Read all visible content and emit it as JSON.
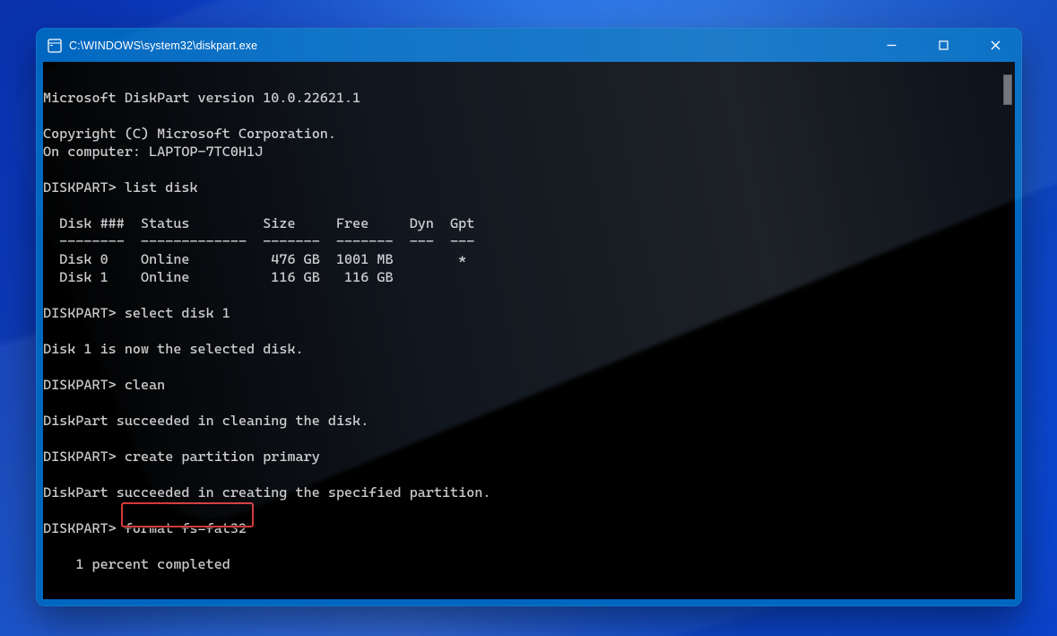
{
  "window": {
    "title": "C:\\WINDOWS\\system32\\diskpart.exe"
  },
  "terminal": {
    "header": {
      "version_line": "Microsoft DiskPart version 10.0.22621.1",
      "copyright_line": "Copyright (C) Microsoft Corporation.",
      "computer_line": "On computer: LAPTOP-7TC0H1J"
    },
    "prompt": "DISKPART>",
    "commands": {
      "list_disk": "list disk",
      "select_disk": "select disk 1",
      "clean": "clean",
      "create_partition": "create partition primary",
      "format": "format fs=fat32"
    },
    "table_header": "  Disk ###  Status         Size     Free     Dyn  Gpt",
    "table_divider": "  --------  -------------  -------  -------  ---  ---",
    "disks": [
      {
        "row": "  Disk 0    Online          476 GB  1001 MB        *"
      },
      {
        "row": "  Disk 1    Online          116 GB   116 GB"
      }
    ],
    "messages": {
      "selected": "Disk 1 is now the selected disk.",
      "clean_ok": "DiskPart succeeded in cleaning the disk.",
      "create_ok": "DiskPart succeeded in creating the specified partition.",
      "progress": "    1 percent completed"
    },
    "highlight_command": "format fs=fat32"
  }
}
